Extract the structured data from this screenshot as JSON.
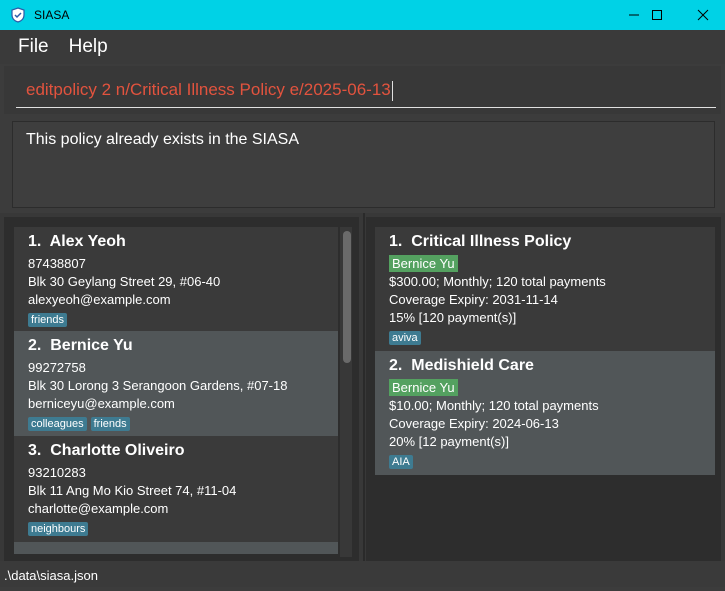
{
  "window": {
    "title": "SIASA"
  },
  "menu": {
    "file": "File",
    "help": "Help"
  },
  "command": {
    "text": "editpolicy 2 n/Critical Illness Policy e/2025-06-13"
  },
  "result": {
    "text": "This policy already exists in the SIASA"
  },
  "persons": [
    {
      "index": "1.",
      "name": "Alex Yeoh",
      "phone": "87438807",
      "address": "Blk 30 Geylang Street 29, #06-40",
      "email": "alexyeoh@example.com",
      "tags": [
        "friends"
      ]
    },
    {
      "index": "2.",
      "name": "Bernice Yu",
      "phone": "99272758",
      "address": "Blk 30 Lorong 3 Serangoon Gardens, #07-18",
      "email": "berniceyu@example.com",
      "tags": [
        "colleagues",
        "friends"
      ]
    },
    {
      "index": "3.",
      "name": "Charlotte Oliveiro",
      "phone": "93210283",
      "address": "Blk 11 Ang Mo Kio Street 74, #11-04",
      "email": "charlotte@example.com",
      "tags": [
        "neighbours"
      ]
    }
  ],
  "policies": [
    {
      "index": "1.",
      "name": "Critical Illness Policy",
      "owner": "Bernice Yu",
      "payment": "$300.00; Monthly; 120 total payments",
      "expiry": "Coverage Expiry: 2031-11-14",
      "commission": "15% [120 payment(s)]",
      "tags": [
        "aviva"
      ]
    },
    {
      "index": "2.",
      "name": "Medishield Care",
      "owner": "Bernice Yu",
      "payment": "$10.00; Monthly; 120 total payments",
      "expiry": "Coverage Expiry: 2024-06-13",
      "commission": "20% [12 payment(s)]",
      "tags": [
        "AIA"
      ]
    }
  ],
  "status": {
    "path": ".\\data\\siasa.json"
  },
  "icons": {
    "app": "shield-icon",
    "minimize": "minimize-icon",
    "maximize": "maximize-icon",
    "close": "close-icon"
  },
  "colors": {
    "titlebar": "#00d2e6",
    "tag": "#3e7b91",
    "owner_chip": "#54a160",
    "command_text": "#e2533e"
  }
}
